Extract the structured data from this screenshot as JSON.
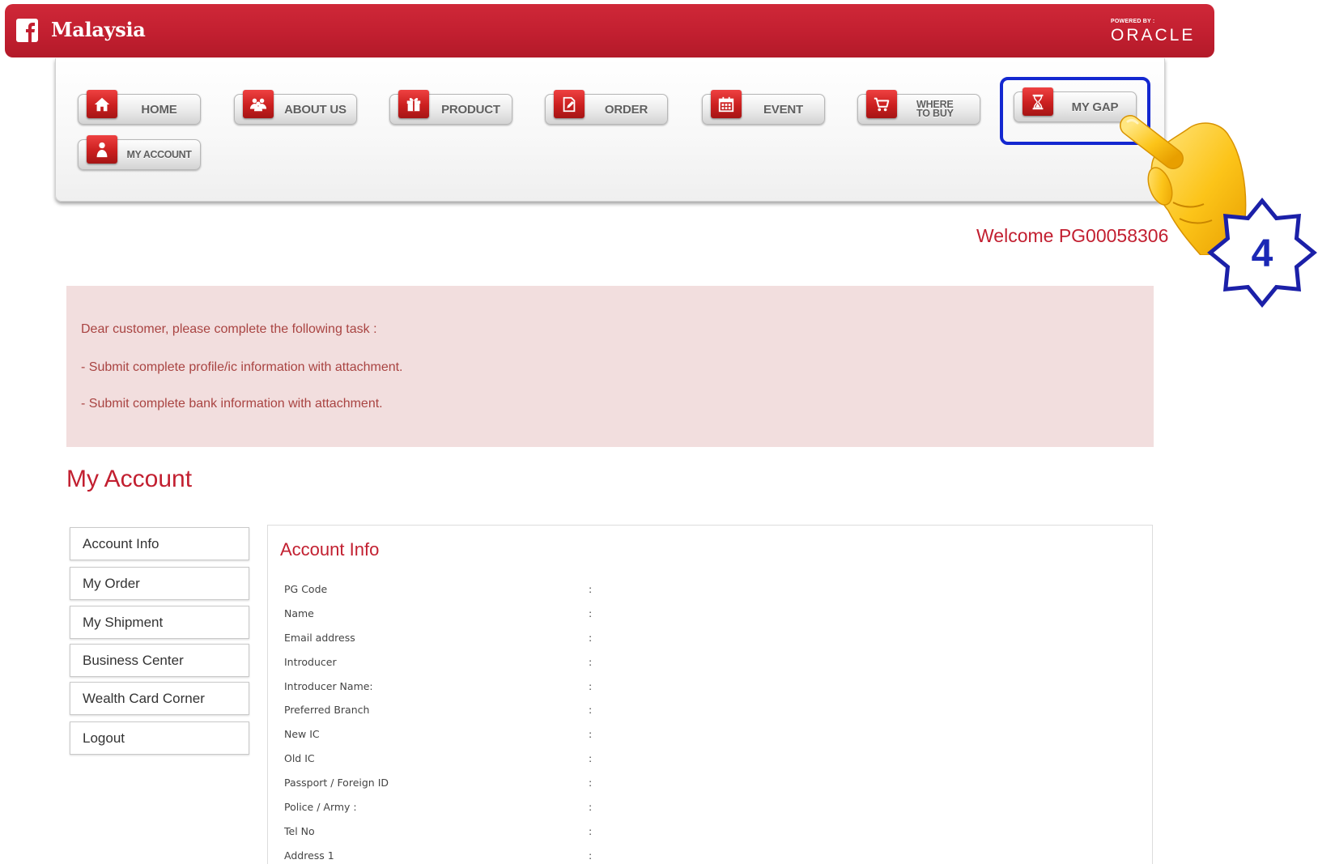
{
  "header": {
    "logo_icon": "facebook-icon",
    "title": "Malaysia",
    "powered_by": "POWERED BY :",
    "partner": "ORACLE"
  },
  "nav": {
    "items": [
      {
        "label": "HOME",
        "icon": "home-icon"
      },
      {
        "label": "ABOUT US",
        "icon": "users-icon"
      },
      {
        "label": "PRODUCT",
        "icon": "gift-icon"
      },
      {
        "label": "ORDER",
        "icon": "edit-document-icon"
      },
      {
        "label": "EVENT",
        "icon": "calendar-icon"
      },
      {
        "label": "WHERE",
        "label_2": "TO BUY",
        "icon": "cart-icon"
      },
      {
        "label": "MY GAP",
        "icon": "hourglass-icon"
      },
      {
        "label": "MY ACCOUNT",
        "icon": "user-icon"
      }
    ]
  },
  "annotation": {
    "step_number": "4",
    "pointer_icon": "pointing-hand-icon"
  },
  "welcome": "Welcome PG00058306",
  "notice": {
    "intro": "Dear customer, please complete the following task :",
    "tasks": [
      "- Submit complete profile/ic information with attachment.",
      "- Submit complete bank information with attachment."
    ]
  },
  "account": {
    "heading": "My Account",
    "sidebar": [
      "Account Info",
      "My Order",
      "My Shipment",
      "Business Center",
      "Wealth Card Corner",
      "Logout"
    ],
    "panel_title": "Account Info",
    "separator": ":",
    "fields": [
      "PG Code",
      "Name",
      "Email address",
      "Introducer",
      "Introducer Name:",
      "Preferred Branch",
      "New IC",
      "Old IC",
      "Passport / Foreign ID",
      "Police / Army :",
      "Tel No",
      "Address 1"
    ]
  },
  "colors": {
    "brand_red": "#c21f30",
    "notice_bg": "#f2dede",
    "notice_text": "#a94442",
    "highlight_blue": "#1428d0",
    "star_blue": "#1b20a8"
  }
}
